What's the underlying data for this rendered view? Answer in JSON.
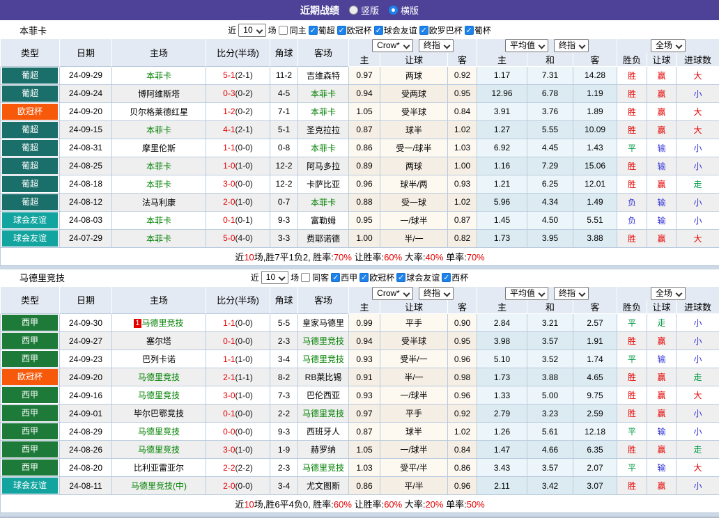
{
  "titlebar": {
    "title": "近期战绩",
    "radio_vertical": "竖版",
    "radio_horizontal": "横版"
  },
  "table_header": {
    "cols": {
      "type": "类型",
      "date": "日期",
      "home": "主场",
      "score": "比分(半场)",
      "corner": "角球",
      "away": "客场",
      "h": "主",
      "handicap": "让球",
      "a": "客",
      "avg_h": "主",
      "draw": "和",
      "avg_a": "客",
      "result": "胜负",
      "handicap_res": "让球",
      "goals": "进球数"
    },
    "selects": {
      "crow": "Crow*",
      "final1": "终指",
      "avg": "平均值",
      "final2": "终指",
      "scope": "全场"
    }
  },
  "filter_shared": {
    "near": "近",
    "games_value": "10",
    "games_suffix": "场"
  },
  "check_glyph": "✓",
  "league_colors": {
    "葡超": "#1b6f6b",
    "欧冠杯": "#f7590a",
    "球会友谊": "#13a4a0",
    "西甲": "#1d7a39"
  },
  "result_colors": {
    "胜": "red",
    "平": "green",
    "负": "blue",
    "赢": "red",
    "输": "blue",
    "走": "green",
    "大": "red",
    "小": "blue"
  },
  "sections": [
    {
      "team": "本菲卡",
      "same_label": "同主",
      "leagues": [
        "葡超",
        "欧冠杯",
        "球会友谊",
        "欧罗巴杯",
        "葡杯"
      ],
      "rows": [
        {
          "league": "葡超",
          "date": "24-09-29",
          "home": "本菲卡",
          "home_main": true,
          "score": "5-1",
          "half": "(2-1)",
          "corner": "11-2",
          "away": "吉维森特",
          "away_main": false,
          "crow": [
            "0.97",
            "两球",
            "0.92"
          ],
          "avg": [
            "1.17",
            "7.31",
            "14.28"
          ],
          "results": [
            "胜",
            "赢",
            "大"
          ]
        },
        {
          "league": "葡超",
          "date": "24-09-24",
          "home": "博阿维斯塔",
          "home_main": false,
          "score": "0-3",
          "half": "(0-2)",
          "corner": "4-5",
          "away": "本菲卡",
          "away_main": true,
          "crow": [
            "0.94",
            "受两球",
            "0.95"
          ],
          "avg": [
            "12.96",
            "6.78",
            "1.19"
          ],
          "results": [
            "胜",
            "赢",
            "小"
          ]
        },
        {
          "league": "欧冠杯",
          "date": "24-09-20",
          "home": "贝尔格莱德红星",
          "home_main": false,
          "score": "1-2",
          "half": "(0-2)",
          "corner": "7-1",
          "away": "本菲卡",
          "away_main": true,
          "crow": [
            "1.05",
            "受半球",
            "0.84"
          ],
          "avg": [
            "3.91",
            "3.76",
            "1.89"
          ],
          "results": [
            "胜",
            "赢",
            "大"
          ]
        },
        {
          "league": "葡超",
          "date": "24-09-15",
          "home": "本菲卡",
          "home_main": true,
          "score": "4-1",
          "half": "(2-1)",
          "corner": "5-1",
          "away": "圣克拉拉",
          "away_main": false,
          "crow": [
            "0.87",
            "球半",
            "1.02"
          ],
          "avg": [
            "1.27",
            "5.55",
            "10.09"
          ],
          "results": [
            "胜",
            "赢",
            "大"
          ]
        },
        {
          "league": "葡超",
          "date": "24-08-31",
          "home": "摩里伦斯",
          "home_main": false,
          "score": "1-1",
          "half": "(0-0)",
          "corner": "0-8",
          "away": "本菲卡",
          "away_main": true,
          "crow": [
            "0.86",
            "受一/球半",
            "1.03"
          ],
          "avg": [
            "6.92",
            "4.45",
            "1.43"
          ],
          "results": [
            "平",
            "输",
            "小"
          ]
        },
        {
          "league": "葡超",
          "date": "24-08-25",
          "home": "本菲卡",
          "home_main": true,
          "score": "1-0",
          "half": "(1-0)",
          "corner": "12-2",
          "away": "阿马多拉",
          "away_main": false,
          "crow": [
            "0.89",
            "两球",
            "1.00"
          ],
          "avg": [
            "1.16",
            "7.29",
            "15.06"
          ],
          "results": [
            "胜",
            "输",
            "小"
          ]
        },
        {
          "league": "葡超",
          "date": "24-08-18",
          "home": "本菲卡",
          "home_main": true,
          "score": "3-0",
          "half": "(0-0)",
          "corner": "12-2",
          "away": "卡萨比亚",
          "away_main": false,
          "crow": [
            "0.96",
            "球半/两",
            "0.93"
          ],
          "avg": [
            "1.21",
            "6.25",
            "12.01"
          ],
          "results": [
            "胜",
            "赢",
            "走"
          ]
        },
        {
          "league": "葡超",
          "date": "24-08-12",
          "home": "法马利康",
          "home_main": false,
          "score": "2-0",
          "half": "(1-0)",
          "corner": "0-7",
          "away": "本菲卡",
          "away_main": true,
          "crow": [
            "0.88",
            "受一球",
            "1.02"
          ],
          "avg": [
            "5.96",
            "4.34",
            "1.49"
          ],
          "results": [
            "负",
            "输",
            "小"
          ]
        },
        {
          "league": "球会友谊",
          "date": "24-08-03",
          "home": "本菲卡",
          "home_main": true,
          "score": "0-1",
          "half": "(0-1)",
          "corner": "9-3",
          "away": "富勒姆",
          "away_main": false,
          "crow": [
            "0.95",
            "一/球半",
            "0.87"
          ],
          "avg": [
            "1.45",
            "4.50",
            "5.51"
          ],
          "results": [
            "负",
            "输",
            "小"
          ]
        },
        {
          "league": "球会友谊",
          "date": "24-07-29",
          "home": "本菲卡",
          "home_main": true,
          "score": "5-0",
          "half": "(4-0)",
          "corner": "3-3",
          "away": "费耶诺德",
          "away_main": false,
          "crow": [
            "1.00",
            "半/一",
            "0.82"
          ],
          "avg": [
            "1.73",
            "3.95",
            "3.88"
          ],
          "results": [
            "胜",
            "赢",
            "大"
          ]
        }
      ],
      "summary": [
        {
          "t": "近"
        },
        {
          "t": "10",
          "r": 1
        },
        {
          "t": "场,胜7平1负2, 胜率:"
        },
        {
          "t": "70%",
          "r": 1
        },
        {
          "t": " 让胜率:"
        },
        {
          "t": "60%",
          "r": 1
        },
        {
          "t": " 大率:"
        },
        {
          "t": "40%",
          "r": 1
        },
        {
          "t": " 单率:"
        },
        {
          "t": "70%",
          "r": 1
        }
      ]
    },
    {
      "team": "马德里竞技",
      "same_label": "同客",
      "leagues": [
        "西甲",
        "欧冠杯",
        "球会友谊",
        "西杯"
      ],
      "rows": [
        {
          "league": "西甲",
          "date": "24-09-30",
          "home": "马德里竞技",
          "home_main": true,
          "home_rank": "1",
          "score": "1-1",
          "half": "(0-0)",
          "corner": "5-5",
          "away": "皇家马德里",
          "away_main": false,
          "crow": [
            "0.99",
            "平手",
            "0.90"
          ],
          "avg": [
            "2.84",
            "3.21",
            "2.57"
          ],
          "results": [
            "平",
            "走",
            "小"
          ]
        },
        {
          "league": "西甲",
          "date": "24-09-27",
          "home": "塞尔塔",
          "home_main": false,
          "score": "0-1",
          "half": "(0-0)",
          "corner": "2-3",
          "away": "马德里竞技",
          "away_main": true,
          "crow": [
            "0.94",
            "受半球",
            "0.95"
          ],
          "avg": [
            "3.98",
            "3.57",
            "1.91"
          ],
          "results": [
            "胜",
            "赢",
            "小"
          ]
        },
        {
          "league": "西甲",
          "date": "24-09-23",
          "home": "巴列卡诺",
          "home_main": false,
          "score": "1-1",
          "half": "(1-0)",
          "corner": "3-4",
          "away": "马德里竞技",
          "away_main": true,
          "crow": [
            "0.93",
            "受半/一",
            "0.96"
          ],
          "avg": [
            "5.10",
            "3.52",
            "1.74"
          ],
          "results": [
            "平",
            "输",
            "小"
          ]
        },
        {
          "league": "欧冠杯",
          "date": "24-09-20",
          "home": "马德里竞技",
          "home_main": true,
          "score": "2-1",
          "half": "(1-1)",
          "corner": "8-2",
          "away": "RB莱比锡",
          "away_main": false,
          "crow": [
            "0.91",
            "半/一",
            "0.98"
          ],
          "avg": [
            "1.73",
            "3.88",
            "4.65"
          ],
          "results": [
            "胜",
            "赢",
            "走"
          ]
        },
        {
          "league": "西甲",
          "date": "24-09-16",
          "home": "马德里竞技",
          "home_main": true,
          "score": "3-0",
          "half": "(1-0)",
          "corner": "7-3",
          "away": "巴伦西亚",
          "away_main": false,
          "crow": [
            "0.93",
            "一/球半",
            "0.96"
          ],
          "avg": [
            "1.33",
            "5.00",
            "9.75"
          ],
          "results": [
            "胜",
            "赢",
            "大"
          ]
        },
        {
          "league": "西甲",
          "date": "24-09-01",
          "home": "毕尔巴鄂竞技",
          "home_main": false,
          "score": "0-1",
          "half": "(0-0)",
          "corner": "2-2",
          "away": "马德里竞技",
          "away_main": true,
          "crow": [
            "0.97",
            "平手",
            "0.92"
          ],
          "avg": [
            "2.79",
            "3.23",
            "2.59"
          ],
          "results": [
            "胜",
            "赢",
            "小"
          ]
        },
        {
          "league": "西甲",
          "date": "24-08-29",
          "home": "马德里竞技",
          "home_main": true,
          "score": "0-0",
          "half": "(0-0)",
          "corner": "9-3",
          "away": "西班牙人",
          "away_main": false,
          "crow": [
            "0.87",
            "球半",
            "1.02"
          ],
          "avg": [
            "1.26",
            "5.61",
            "12.18"
          ],
          "results": [
            "平",
            "输",
            "小"
          ]
        },
        {
          "league": "西甲",
          "date": "24-08-26",
          "home": "马德里竞技",
          "home_main": true,
          "score": "3-0",
          "half": "(1-0)",
          "corner": "1-9",
          "away": "赫罗纳",
          "away_main": false,
          "crow": [
            "1.05",
            "一/球半",
            "0.84"
          ],
          "avg": [
            "1.47",
            "4.66",
            "6.35"
          ],
          "results": [
            "胜",
            "赢",
            "走"
          ]
        },
        {
          "league": "西甲",
          "date": "24-08-20",
          "home": "比利亚雷亚尔",
          "home_main": false,
          "score": "2-2",
          "half": "(2-2)",
          "corner": "2-3",
          "away": "马德里竞技",
          "away_main": true,
          "crow": [
            "1.03",
            "受平/半",
            "0.86"
          ],
          "avg": [
            "3.43",
            "3.57",
            "2.07"
          ],
          "results": [
            "平",
            "输",
            "大"
          ]
        },
        {
          "league": "球会友谊",
          "date": "24-08-11",
          "home": "马德里竞技(中)",
          "home_main": true,
          "score": "2-0",
          "half": "(0-0)",
          "corner": "3-4",
          "away": "尤文图斯",
          "away_main": false,
          "crow": [
            "0.86",
            "平/半",
            "0.96"
          ],
          "avg": [
            "2.11",
            "3.42",
            "3.07"
          ],
          "results": [
            "胜",
            "赢",
            "小"
          ]
        }
      ],
      "summary": [
        {
          "t": "近"
        },
        {
          "t": "10",
          "r": 1
        },
        {
          "t": "场,胜6平4负0, 胜率:"
        },
        {
          "t": "60%",
          "r": 1
        },
        {
          "t": " 让胜率:"
        },
        {
          "t": "60%",
          "r": 1
        },
        {
          "t": " 大率:"
        },
        {
          "t": "20%",
          "r": 1
        },
        {
          "t": " 单率:"
        },
        {
          "t": "50%",
          "r": 1
        }
      ]
    }
  ]
}
